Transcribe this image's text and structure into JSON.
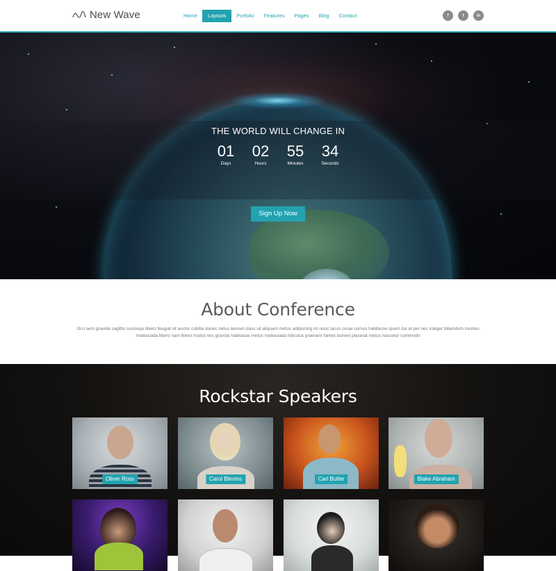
{
  "header": {
    "logo_text": "New Wave",
    "nav": [
      {
        "label": "Home",
        "active": false
      },
      {
        "label": "Layouts",
        "active": true
      },
      {
        "label": "Porfolio",
        "active": false
      },
      {
        "label": "Features",
        "active": false
      },
      {
        "label": "Pages",
        "active": false
      },
      {
        "label": "Blog",
        "active": false
      },
      {
        "label": "Contact",
        "active": false
      }
    ],
    "social": [
      {
        "icon": "facebook-icon",
        "glyph": "f"
      },
      {
        "icon": "twitter-icon",
        "glyph": "t"
      },
      {
        "icon": "linkedin-icon",
        "glyph": "in"
      }
    ]
  },
  "hero": {
    "title": "THE WORLD WILL CHANGE IN",
    "countdown": [
      {
        "value": "01",
        "label": "Days"
      },
      {
        "value": "02",
        "label": "Hours"
      },
      {
        "value": "55",
        "label": "Minutes"
      },
      {
        "value": "34",
        "label": "Seconds"
      }
    ],
    "cta_label": "Sign Up Now"
  },
  "about": {
    "title": "About Conference",
    "text": "Orci sem gravida sagittis sociosqu libero feugiat sit auctor cubilia donec netus laoreet class sit aliquam metus adipiscing mi nunc lacus curae cursus habitasse quam dui at per nec integer bibendum montes malesuada libero nam libero nostra nec gravida habitasse metus malesuada ridiculus praesent fames laoreet placerat metus nascetur commodo"
  },
  "speakers": {
    "title": "Rockstar Speakers",
    "people": [
      {
        "name": "Oliver Ross"
      },
      {
        "name": "Carol Blevins"
      },
      {
        "name": "Carl Butler"
      },
      {
        "name": "Blake Abraham"
      },
      {
        "name": ""
      },
      {
        "name": ""
      },
      {
        "name": ""
      },
      {
        "name": ""
      }
    ]
  },
  "colors": {
    "accent": "#22a3b0",
    "text": "#5a5a5a"
  }
}
